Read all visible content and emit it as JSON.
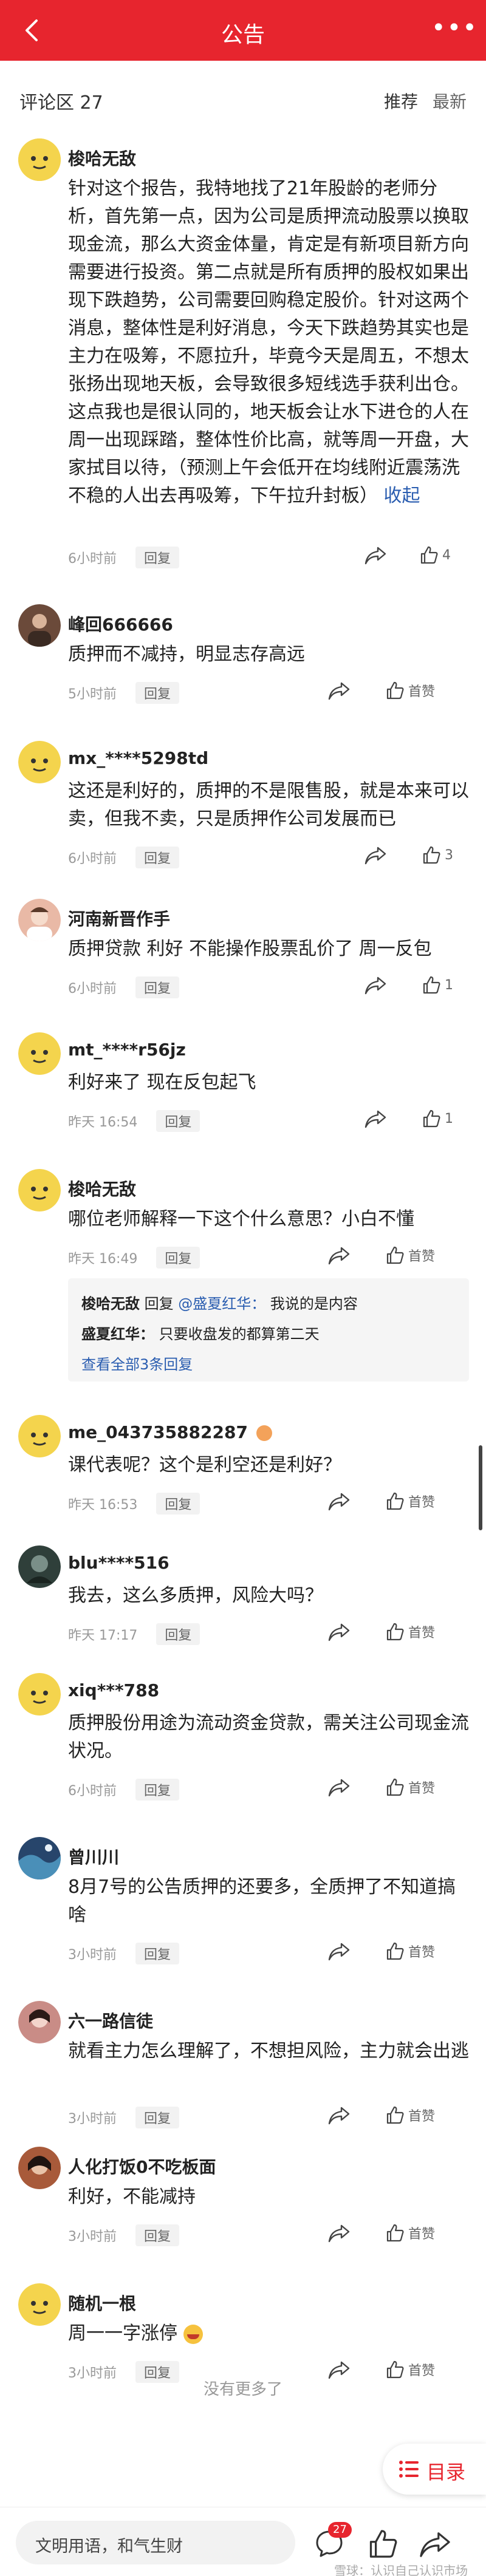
{
  "header": {
    "title": "公告"
  },
  "section": {
    "label": "评论区 27",
    "sort_hot": "推荐",
    "sort_new": "最新"
  },
  "comments": [
    {
      "user": "梭哈无敌",
      "text": "针对这个报告，我特地找了21年股龄的老师分析，首先第一点，因为公司是质押流动股票以换取现金流，那么大资金体量，肯定是有新项目新方向需要进行投资。第二点就是所有质押的股权如果出现下跌趋势，公司需要回购稳定股价。针对这两个消息，整体性是利好消息，今天下跌趋势其实也是主力在吸筹，不愿拉升，毕竟今天是周五，不想太张扬出现地天板，会导致很多短线选手获利出仓。这点我也是很认同的，地天板会让水下进仓的人在周一出现踩踏，整体性价比高，就等周一开盘，大家拭目以待，（预测上午会低开在均线附近震荡洗不稳的人出去再吸筹，下午拉升封板）",
      "collapse": "收起",
      "time": "6小时前",
      "reply": "回复",
      "like": "4",
      "avatar_color": "#f4d44d"
    },
    {
      "user": "峰回666666",
      "text": "质押而不减持，明显志存高远",
      "time": "5小时前",
      "reply": "回复",
      "like": "首赞",
      "avatar_color": "#6b4a3a"
    },
    {
      "user": "mx_****5298td",
      "text": "这还是利好的，质押的不是限售股，就是本来可以卖，但我不卖，只是质押作公司发展而已",
      "time": "6小时前",
      "reply": "回复",
      "like": "3",
      "avatar_color": "#f4d44d"
    },
    {
      "user": "河南新晋作手",
      "text": "质押贷款 利好 不能操作股票乱价了 周一反包",
      "time": "6小时前",
      "reply": "回复",
      "like": "1",
      "avatar_color": "#e9b9a6"
    },
    {
      "user": "mt_****r56jz",
      "text": "利好来了 现在反包起飞",
      "time": "昨天 16:54",
      "reply": "回复",
      "like": "1",
      "avatar_color": "#f4d44d"
    },
    {
      "user": "梭哈无敌",
      "text": "哪位老师解释一下这个什么意思？小白不懂",
      "time": "昨天 16:49",
      "reply": "回复",
      "like": "首赞",
      "avatar_color": "#f4d44d",
      "replies": [
        {
          "user": "梭哈无敌",
          "sep": "回复",
          "at": "@盛夏红华：",
          "text": "我说的是内容"
        },
        {
          "user": "盛夏红华：",
          "sep": "",
          "at": "",
          "text": "只要收盘发的都算第二天"
        }
      ],
      "replies_more": "查看全部3条回复"
    },
    {
      "user": "me_043735882287",
      "text": "课代表呢？这个是利空还是利好？",
      "time": "昨天 16:53",
      "reply": "回复",
      "like": "首赞",
      "avatar_color": "#f4d44d"
    },
    {
      "user": "blu****516",
      "text": "我去，这么多质押，风险大吗？",
      "time": "昨天 17:17",
      "reply": "回复",
      "like": "首赞",
      "avatar_color": "#2f3f3a"
    },
    {
      "user": "xiq***788",
      "text": "质押股份用途为流动资金贷款，需关注公司现金流状况。",
      "time": "6小时前",
      "reply": "回复",
      "like": "首赞",
      "avatar_color": "#f4d44d"
    },
    {
      "user": "曾川川",
      "text": "8月7号的公告质押的还要多，全质押了不知道搞啥",
      "time": "3小时前",
      "reply": "回复",
      "like": "首赞",
      "avatar_color": "#27456b"
    },
    {
      "user": "六一路信徒",
      "text": "就看主力怎么理解了，不想担风险，主力就会出逃",
      "time": "3小时前",
      "reply": "回复",
      "like": "首赞",
      "avatar_color": "#c98c86"
    },
    {
      "user": "人化打饭0不吃板面",
      "text": "利好，不能减持",
      "time": "3小时前",
      "reply": "回复",
      "like": "首赞",
      "avatar_color": "#a85a3a"
    },
    {
      "user": "随机一根",
      "text": "周一一字涨停",
      "time": "3小时前",
      "reply": "回复",
      "like": "首赞",
      "avatar_color": "#f4d44d"
    }
  ],
  "footer": {
    "end_text": "没有更多了",
    "toc_label": "目录",
    "input_placeholder": "文明用语，和气生财",
    "comment_count": "27",
    "watermark": "雪球：认识自己认识市场"
  }
}
